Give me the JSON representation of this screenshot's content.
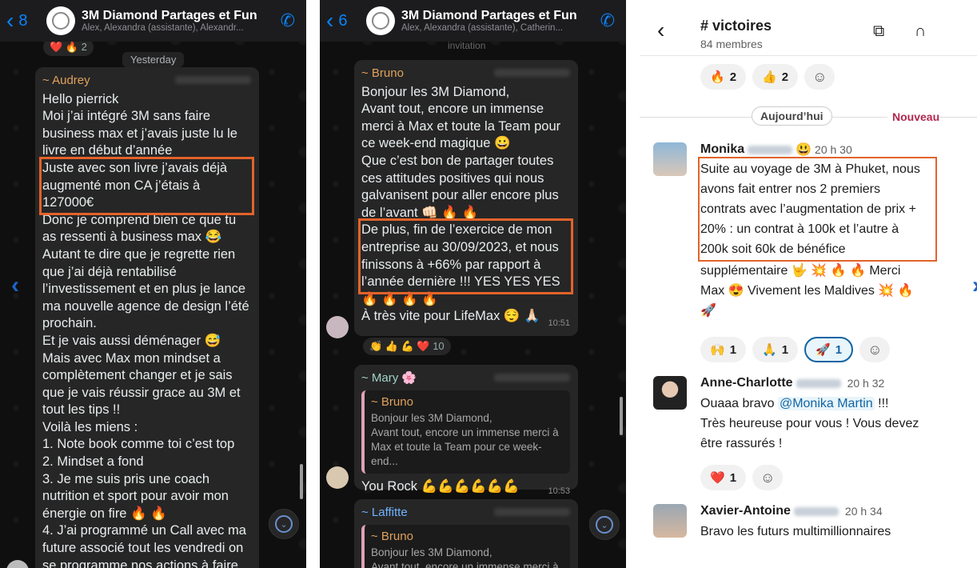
{
  "p1": {
    "back_count": "8",
    "title": "3M Diamond Partages et Fun",
    "subtitle": "Alex, Alexandra (assistante), Alexandr...",
    "top_reactions": "❤️ 🔥 2",
    "day": "Yesterday",
    "sender": "~ Audrey",
    "lines_a": [
      "Hello pierrick",
      "Moi j’ai intégré 3M sans faire",
      "business max et j’avais juste lu le",
      "livre en début d’année"
    ],
    "lines_hl": [
      "Juste avec son livre j’avais déjà",
      "augmenté mon CA j’étais à",
      "127000€"
    ],
    "lines_b": [
      "Donc je comprend bien ce que tu",
      "as ressenti à business max 😂",
      "Autant te dire que je regrette rien",
      "que j’ai déjà rentabilisé",
      "l’investissement et en plus je lance",
      "ma nouvelle agence de design l’été",
      "prochain.",
      "Et je vais aussi déménager 😅",
      "Mais avec Max mon mindset a",
      "complètement changer et je sais",
      "que je vais réussir grace au 3M et",
      "tout les tips !!",
      "Voilà les miens :",
      "1. Note book comme toi c’est top",
      "2. Mindset a fond",
      "3. Je me suis pris une coach",
      "nutrition et sport pour avoir mon",
      "énergie on fire 🔥 🔥",
      "4. J’ai programmé un Call avec ma",
      "future associé tout les vendredi on",
      "se programme nos actions à faire"
    ]
  },
  "p2": {
    "back_count": "6",
    "title": "3M Diamond Partages et Fun",
    "subtitle": "Alex, Alexandra (assistante), Catherin...",
    "top_fade": "invitation",
    "sender": "~ Bruno",
    "lines_a": [
      "Bonjour les 3M Diamond,",
      "Avant tout, encore un immense",
      "merci à Max et toute la Team pour",
      "ce week-end magique 😀",
      "Que c’est bon de partager toutes",
      "ces attitudes positives qui nous",
      "galvanisent pour aller encore plus",
      "de l’avant 👊🏻 🔥 🔥"
    ],
    "lines_hl": [
      "De plus, fin de l’exercice de mon",
      "entreprise au 30/09/2023, et nous",
      "finissons à +66% par rapport à",
      "l’année dernière !!! YES YES YES"
    ],
    "lines_b": [
      "🔥 🔥 🔥 🔥",
      "À très vite pour LifeMax 😌 🙏🏻"
    ],
    "time1": "10:51",
    "reactions": "👏 👍 💪 ❤️ 10",
    "mary": "~ Mary 🌸",
    "quote_name": "~ Bruno",
    "quote_lines": [
      "Bonjour les 3M Diamond,",
      "Avant tout, encore un immense merci à",
      "Max et toute la Team pour ce week-end..."
    ],
    "you_rock": "You Rock 💪💪💪💪💪💪",
    "time2": "10:53",
    "laffitte": "~ Laffitte",
    "quote2_name": "~ Bruno",
    "quote2_lines": [
      "Bonjour les 3M Diamond,",
      "Avant tout, encore un immense merci à"
    ]
  },
  "p3": {
    "channel": "# victoires",
    "members": "84 membres",
    "top_reactions": [
      {
        "e": "🔥",
        "n": "2"
      },
      {
        "e": "👍",
        "n": "2"
      }
    ],
    "today": "Aujourd’hui",
    "new": "Nouveau",
    "m1_name": "Monika",
    "m1_emoji": "😃",
    "m1_time": "20 h 30",
    "m1_hl": [
      "Suite au voyage de 3M à Phuket, nous",
      "avons fait entrer nos 2 premiers",
      "contrats avec l’augmentation de prix +",
      "20% : un contrat à 100k et l’autre à",
      "200k soit 60k de bénéfice"
    ],
    "m1_rest": [
      "supplémentaire 🤟 💥 🔥 🔥 Merci",
      "Max 😍 Vivement les  Maldives 💥 🔥",
      "🚀"
    ],
    "m1_reacts": [
      {
        "e": "🙌",
        "n": "1"
      },
      {
        "e": "🙏",
        "n": "1"
      },
      {
        "e": "🚀",
        "n": "1"
      }
    ],
    "m2_name": "Anne-Charlotte",
    "m2_time": "20 h 32",
    "m2_l1a": "Ouaaa bravo ",
    "m2_mention": "@Monika Martin",
    "m2_l1b": " !!!",
    "m2_lines": [
      "Très heureuse pour vous ! Vous devez",
      "être rassurés !"
    ],
    "m2_react": {
      "e": "❤️",
      "n": "1"
    },
    "m3_name": "Xavier-Antoine",
    "m3_time": "20 h 34",
    "m3_text": "Bravo les futurs multimillionnaires"
  }
}
